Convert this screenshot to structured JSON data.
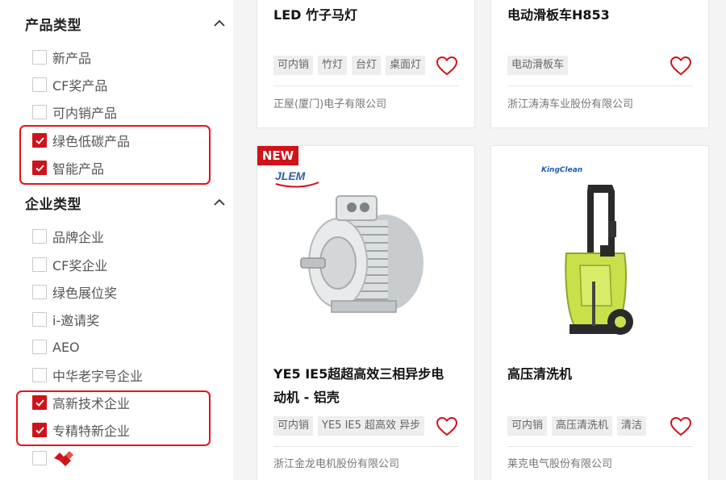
{
  "sidebar": {
    "product_type": {
      "title": "产品类型",
      "options": [
        {
          "label": "新产品",
          "checked": false
        },
        {
          "label": "CF奖产品",
          "checked": false
        },
        {
          "label": "可内销产品",
          "checked": false
        },
        {
          "label": "绿色低碳产品",
          "checked": true
        },
        {
          "label": "智能产品",
          "checked": true
        }
      ]
    },
    "company_type": {
      "title": "企业类型",
      "options": [
        {
          "label": "品牌企业",
          "checked": false
        },
        {
          "label": "CF奖企业",
          "checked": false
        },
        {
          "label": "绿色展位奖",
          "checked": false
        },
        {
          "label": "i-邀请奖",
          "checked": false
        },
        {
          "label": "AEO",
          "checked": false
        },
        {
          "label": "中华老字号企业",
          "checked": false
        },
        {
          "label": "高新技术企业",
          "checked": true
        },
        {
          "label": "专精特新企业",
          "checked": true
        },
        {
          "label": "",
          "checked": false,
          "icon": "brand-mark-icon"
        }
      ]
    }
  },
  "products": [
    {
      "title": "LED 竹子马灯",
      "tags": [
        "可内销",
        "竹灯",
        "台灯",
        "桌面灯"
      ],
      "company": "正屋(厦门)电子有限公司",
      "is_new": false
    },
    {
      "title": "电动滑板车H853",
      "tags": [
        "电动滑板车"
      ],
      "company": "浙江涛涛车业股份有限公司",
      "is_new": false
    },
    {
      "title": "YE5 IE5超超高效三相异步电动机 - 铝壳",
      "tags": [
        "可内销",
        "YE5 IE5 超高效 异步"
      ],
      "company": "浙江金龙电机股份有限公司",
      "is_new": true,
      "new_label": "NEW",
      "logo_text": "JLEM"
    },
    {
      "title": "高压清洗机",
      "tags": [
        "可内销",
        "高压清洗机",
        "清洁"
      ],
      "company": "莱克电气股份有限公司",
      "is_new": false,
      "logo_text": "KingClean"
    }
  ],
  "colors": {
    "accent_red": "#d0121b",
    "highlight_red": "#e8131a"
  }
}
